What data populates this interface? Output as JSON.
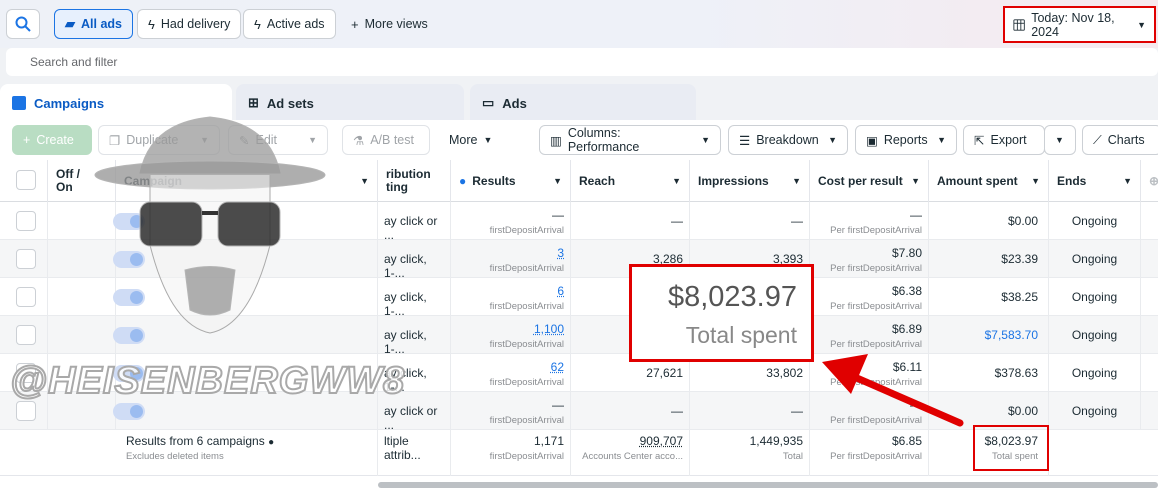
{
  "topbar": {
    "views": [
      "All ads",
      "Had delivery",
      "Active ads"
    ],
    "more_views": "More views",
    "date": "Today: Nov 18, 2024"
  },
  "search": {
    "placeholder": "Search and filter"
  },
  "tabs": [
    "Campaigns",
    "Ad sets",
    "Ads"
  ],
  "toolbar": {
    "create": "Create",
    "duplicate": "Duplicate",
    "edit": "Edit",
    "ab_test": "A/B test",
    "more": "More",
    "columns": "Columns: Performance",
    "breakdown": "Breakdown",
    "reports": "Reports",
    "export": "Export",
    "charts": "Charts"
  },
  "columns": {
    "off_on": "Off / On",
    "campaign": "Campaign",
    "attribution": "ribution ting",
    "results": "Results",
    "reach": "Reach",
    "impressions": "Impressions",
    "cost_per_result": "Cost per result",
    "amount_spent": "Amount spent",
    "ends": "Ends"
  },
  "rows": [
    {
      "attr": "ay click or ...",
      "results": "—",
      "results_sub": "firstDepositArrival",
      "reach": "—",
      "impressions": "—",
      "cpr": "—",
      "cpr_sub": "Per firstDepositArrival",
      "spent": "$0.00",
      "ends": "Ongoing"
    },
    {
      "attr": "ay click, 1-...",
      "results": "3",
      "results_sub": "firstDepositArrival",
      "reach": "3,286",
      "impressions": "3,393",
      "cpr": "$7.80",
      "cpr_sub": "Per firstDepositArrival",
      "spent": "$23.39",
      "ends": "Ongoing"
    },
    {
      "attr": "ay click, 1-...",
      "results": "6",
      "results_sub": "firstDepositArrival",
      "reach": "",
      "impressions": "",
      "cpr": "$6.38",
      "cpr_sub": "Per firstDepositArrival",
      "spent": "$38.25",
      "ends": "Ongoing"
    },
    {
      "attr": "ay click, 1-...",
      "results": "1,100",
      "results_sub": "firstDepositArrival",
      "reach": "",
      "impressions": "",
      "cpr": "$6.89",
      "cpr_sub": "Per firstDepositArrival",
      "spent": "$7,583.70",
      "ends": "Ongoing"
    },
    {
      "attr": "ay click, 1-...",
      "results": "62",
      "results_sub": "firstDepositArrival",
      "reach": "27,621",
      "impressions": "33,802",
      "cpr": "$6.11",
      "cpr_sub": "Per firstDepositArrival",
      "spent": "$378.63",
      "ends": "Ongoing"
    },
    {
      "attr": "ay click or ...",
      "results": "—",
      "results_sub": "firstDepositArrival",
      "reach": "—",
      "impressions": "—",
      "cpr": "—",
      "cpr_sub": "Per firstDepositArrival",
      "spent": "$0.00",
      "ends": "Ongoing"
    }
  ],
  "totals": {
    "label": "Results from 6 campaigns",
    "sublabel": "Excludes deleted items",
    "attr": "ltiple attrib...",
    "results": "1,171",
    "results_sub": "firstDepositArrival",
    "reach": "909,707",
    "reach_sub": "Accounts Center acco...",
    "impressions": "1,449,935",
    "impressions_sub": "Total",
    "cpr": "$6.85",
    "cpr_sub": "Per firstDepositArrival",
    "spent": "$8,023.97",
    "spent_sub": "Total spent"
  },
  "callout": {
    "amount": "$8,023.97",
    "label": "Total spent"
  },
  "watermark": "@HEISENBERGWW8",
  "colors": {
    "accent": "#1b74e4",
    "highlight": "#e00000"
  }
}
